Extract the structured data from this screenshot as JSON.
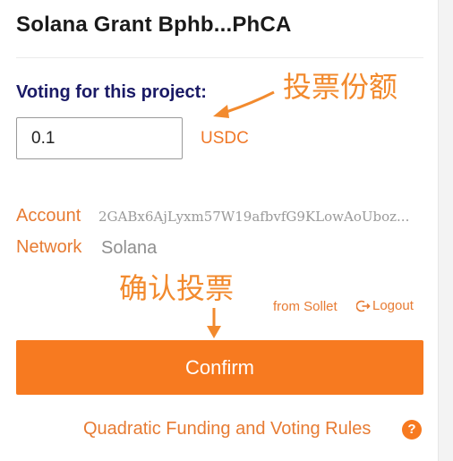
{
  "project": {
    "title": "Solana Grant Bphb...PhCA"
  },
  "voting": {
    "label": "Voting for this project:",
    "amount": "0.1",
    "currency": "USDC"
  },
  "account": {
    "label": "Account",
    "value": "2GABx6AjLyxm57W19afbvfG9KLowAoUboz..."
  },
  "network": {
    "label": "Network",
    "value": "Solana"
  },
  "wallet": {
    "source": "from Sollet",
    "logout_label": "Logout"
  },
  "confirm_label": "Confirm",
  "rules_link": "Quadratic Funding and Voting Rules",
  "annotations": {
    "vote_amount": "投票份额",
    "confirm_vote": "确认投票"
  },
  "colors": {
    "accent": "#f77a20",
    "label_orange": "#e77b33",
    "heading_navy": "#1a1a66"
  },
  "icons": {
    "logout": "logout-icon",
    "help": "help-icon"
  }
}
